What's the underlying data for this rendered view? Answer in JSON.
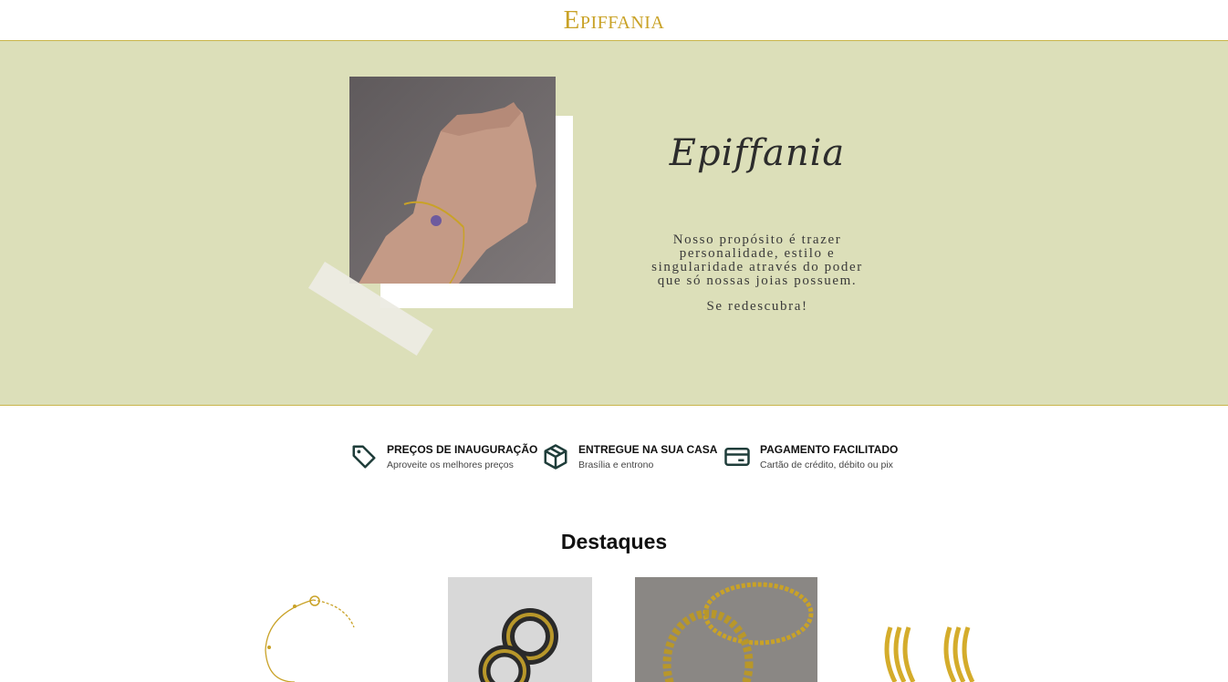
{
  "header": {
    "logo": "Epiffania"
  },
  "hero": {
    "script_title": "Epiffania",
    "text": "Nosso propósito é trazer personalidade, estilo e singularidade através do poder que só nossas joias possuem.",
    "subtext": "Se redescubra!"
  },
  "features": [
    {
      "icon": "tag-icon",
      "title": "PREÇOS DE INAUGURAÇÃO",
      "subtitle": "Aproveite os melhores preços"
    },
    {
      "icon": "box-icon",
      "title": "ENTREGUE NA SUA CASA",
      "subtitle": "Brasília e entrono"
    },
    {
      "icon": "credit-card-icon",
      "title": "PAGAMENTO FACILITADO",
      "subtitle": "Cartão de crédito, débito ou pix"
    }
  ],
  "highlights": {
    "title": "Destaques"
  },
  "colors": {
    "gold": "#c9a227",
    "hero_bg": "#dcdfb9",
    "icon": "#1f3d3a"
  }
}
